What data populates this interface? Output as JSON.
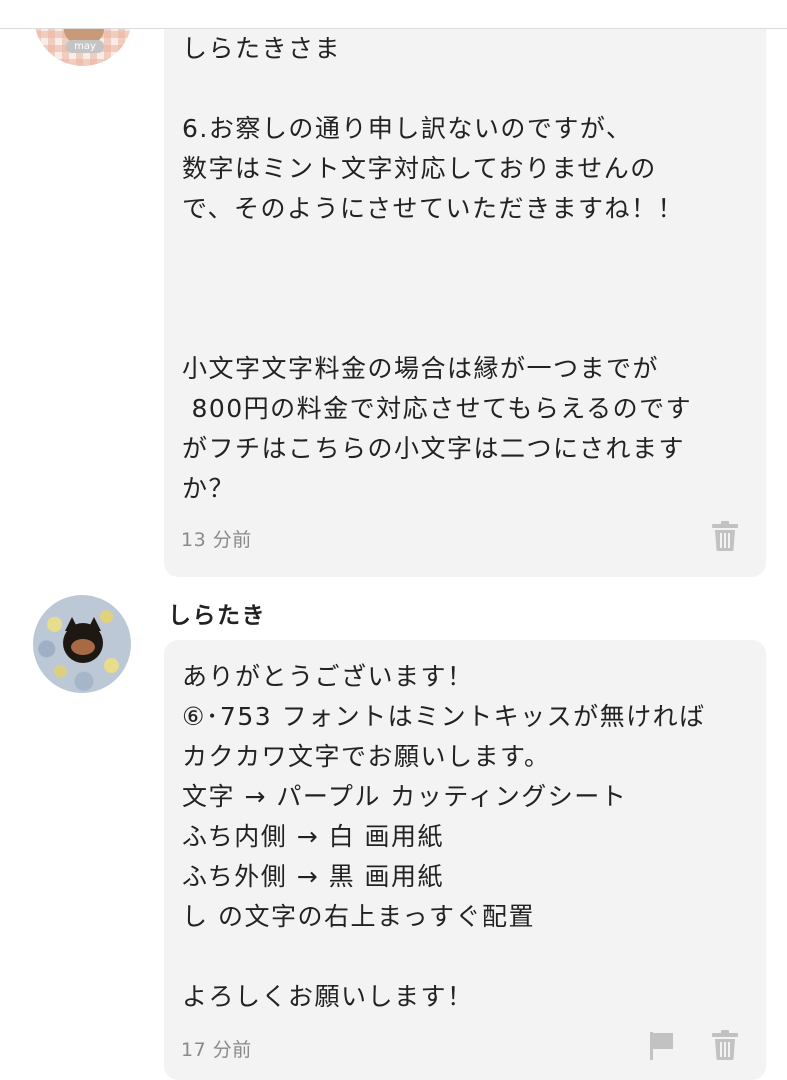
{
  "messages": [
    {
      "sender": "",
      "avatar_tag": "may",
      "text": "しらたきさま\n\n6.お察しの通り申し訳ないのですが、\n数字はミント文字対応しておりませんの\nで、そのようにさせていただきますね！！\n\n\n\n小文字文字料金の場合は縁が一つまでが\n 800円の料金で対応させてもらえるのです\nがフチはこちらの小文字は二つにされます\nか？",
      "time": "13 分前",
      "icons": [
        "trash-icon"
      ]
    },
    {
      "sender": "しらたき",
      "text": "ありがとうございます！\n⑥･753 フォントはミントキッスが無ければ\nカクカワ文字でお願いします。\n文字 → パープル カッティングシート\nふち内側 → 白 画用紙\nふち外側 → 黒 画用紙\nし の文字の右上まっすぐ配置\n\nよろしくお願いします！",
      "time": "17 分前",
      "icons": [
        "flag-icon",
        "trash-icon"
      ]
    }
  ],
  "colors": {
    "bubble_bg": "#f3f3f3",
    "text": "#222222",
    "meta_text": "#8a8a8a",
    "icon": "#c2c2c2"
  }
}
